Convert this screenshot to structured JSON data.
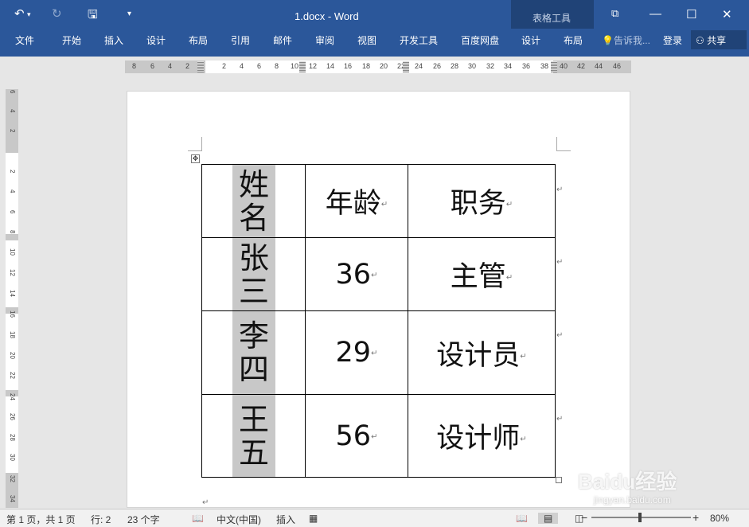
{
  "window": {
    "title": "1.docx - Word",
    "context_title": "表格工具",
    "undo_icon": "undo-icon",
    "redo_icon": "redo-icon",
    "save_icon": "save-icon",
    "customize_icon": "chevron-down-icon"
  },
  "ribbon": {
    "tabs": [
      "文件",
      "开始",
      "插入",
      "设计",
      "布局",
      "引用",
      "邮件",
      "审阅",
      "视图",
      "开发工具",
      "百度网盘"
    ],
    "context_tabs": [
      "设计",
      "布局"
    ],
    "tell_me": "告诉我...",
    "login": "登录",
    "share": "共享"
  },
  "ruler": {
    "horizontal_left": [
      "8",
      "6",
      "4",
      "2"
    ],
    "horizontal_right": [
      "2",
      "4",
      "6",
      "8",
      "10",
      "12",
      "14",
      "16",
      "18",
      "20",
      "22",
      "24",
      "26",
      "28",
      "30",
      "32",
      "34",
      "36",
      "38",
      "40",
      "42",
      "44",
      "46"
    ],
    "vertical": [
      "6",
      "4",
      "2",
      "2",
      "4",
      "6",
      "8",
      "10",
      "12",
      "14",
      "16",
      "18",
      "20",
      "22",
      "24",
      "26",
      "28",
      "30",
      "32",
      "34"
    ]
  },
  "table": {
    "rows": [
      {
        "name_chars": [
          "姓",
          "名"
        ],
        "age": "年龄",
        "title": "职务"
      },
      {
        "name_chars": [
          "张",
          "三"
        ],
        "age": "36",
        "title": "主管"
      },
      {
        "name_chars": [
          "李",
          "四"
        ],
        "age": "29",
        "title": "设计员"
      },
      {
        "name_chars": [
          "王",
          "五"
        ],
        "age": "56",
        "title": "设计师"
      }
    ]
  },
  "status": {
    "page": "第 1 页，共 1 页",
    "row": "行: 2",
    "words": "23 个字",
    "language": "中文(中国)",
    "mode": "插入",
    "zoom": "80%"
  },
  "watermark": {
    "brand": "Baidu经验",
    "url": "jingyan.baidu.com"
  }
}
